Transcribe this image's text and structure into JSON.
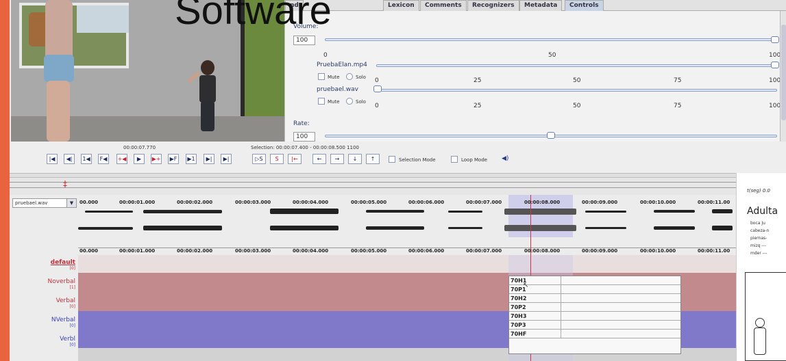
{
  "overlay": {
    "title": "Software"
  },
  "tabs": [
    "nd",
    "Lexicon",
    "Comments",
    "Recognizers",
    "Metadata",
    "Controls"
  ],
  "active_tab": "Controls",
  "controls": {
    "volume_label": "Volume:",
    "volume_value": "100",
    "volume_ticks": [
      "0",
      "50",
      "100"
    ],
    "media1_name": "PruebaElan.mp4",
    "media2_name": "pruebael.wav",
    "mute_label": "Mute",
    "solo_label": "Solo",
    "media_ticks": [
      "0",
      "25",
      "50",
      "75",
      "100"
    ],
    "rate_label": "Rate:",
    "rate_value": "100"
  },
  "player": {
    "time": "00:00:07.770",
    "selection": "Selection: 00:00:07.400 - 00:00:08.500  1100",
    "selection_mode": "Selection Mode",
    "loop_mode": "Loop Mode",
    "buttons": [
      "|◀",
      "◀|",
      "1◀",
      "F◀",
      "+◀",
      "▶",
      "▶+",
      "▶F",
      "▶1",
      "▶|",
      "▶|"
    ],
    "sel_buttons": [
      "▷S",
      "S",
      "|←"
    ],
    "nav_buttons": [
      "←",
      "→",
      "↓",
      "↑"
    ],
    "speaker": "◀)"
  },
  "waveform": {
    "file": "pruebael.wav",
    "times": [
      "00.000",
      "00:00:01.000",
      "00:00:02.000",
      "00:00:03.000",
      "00:00:04.000",
      "00:00:05.000",
      "00:00:06.000",
      "00:00:07.000",
      "00:00:08.000",
      "00:00:09.000",
      "00:00:10.000",
      "00:00:11.00"
    ]
  },
  "tiers": [
    {
      "name": "default",
      "count": "[0]",
      "color": "#c0303a"
    },
    {
      "name": "Noverbal",
      "count": "[1]",
      "color": "#c0303a"
    },
    {
      "name": "Verbal",
      "count": "[0]",
      "color": "#c0303a"
    },
    {
      "name": "NVerbal",
      "count": "[0]",
      "color": "#3a40c0"
    },
    {
      "name": "Verbl",
      "count": "[0]",
      "color": "#3a40c0"
    }
  ],
  "dropdown_rows": [
    "70H1",
    "70P1",
    "70H2",
    "70P2",
    "70H3",
    "70P3",
    "70HF"
  ],
  "document": {
    "header": "t(seg)  0.0",
    "title": "Adulta",
    "lines": [
      "boca  Ju",
      "cabeza-n",
      "piernas-",
      "mizq  ---",
      "mder  ---"
    ]
  }
}
